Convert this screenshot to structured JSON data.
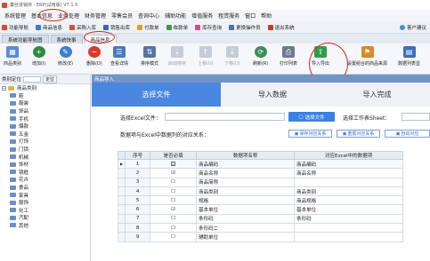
{
  "window": {
    "title": "秦丝进销存 - ERP(试用版) V7.1.5"
  },
  "menu": [
    "系统管理",
    "基本信息",
    "业务处理",
    "财务管理",
    "零售会员",
    "查询中心",
    "辅助功能",
    "增值服务",
    "租赁服务",
    "窗口",
    "帮助"
  ],
  "quickbar": {
    "items": [
      "功能导航",
      "商品信息",
      "采购入库",
      "销售出库",
      "付款单",
      "收款单",
      "库存查询",
      "更换操作员",
      "退出系统"
    ],
    "right": "客户建议"
  },
  "doc_tabs": [
    "系统功能导航图",
    "系统快事",
    "商品信息"
  ],
  "toolbar": [
    {
      "label": "商品类别",
      "color": "#5a8ad8",
      "glyph": "▦"
    },
    {
      "label": "增加(I)",
      "color": "#2e8b3e",
      "glyph": "+"
    },
    {
      "label": "修改(E)",
      "color": "#3b7dd8",
      "glyph": "✎"
    },
    {
      "label": "删除(D)",
      "color": "#d93a2e",
      "glyph": "−"
    },
    {
      "label": "查看详情",
      "color": "#4a79c2",
      "glyph": "☰"
    },
    {
      "label": "排序模式",
      "color": "#5573a8",
      "glyph": "⇅"
    },
    {
      "label": "启动排序",
      "color": "#aab4c0",
      "glyph": "⇣"
    },
    {
      "label": "上移(U)",
      "color": "#aab4c0",
      "glyph": "↑"
    },
    {
      "label": "下移(D)",
      "color": "#aab4c0",
      "glyph": "↓"
    },
    {
      "label": "刷新(R)",
      "color": "#3c8d5a",
      "glyph": "⟳"
    },
    {
      "label": "打印列表",
      "color": "#6b7a90",
      "glyph": "⎙"
    },
    {
      "label": "导入导出",
      "color": "#2f9e4a",
      "glyph": "⇪"
    },
    {
      "label": "设置组合的商品来源",
      "color": "#d88a2a",
      "glyph": "⚑"
    },
    {
      "label": "数据列表显",
      "color": "#3a6fc0",
      "glyph": "▤"
    }
  ],
  "left_panel": {
    "label": "类别定位",
    "button": "定位",
    "tree": [
      "商品类别",
      "鞋",
      "服装",
      "饰品",
      "手机",
      "爆款",
      "五金",
      "灯饰",
      "门锁",
      "机械",
      "饰材",
      "镜框",
      "花卉",
      "食品",
      "家具",
      "服饰",
      "化工",
      "汽配",
      "其他"
    ]
  },
  "main": {
    "title": "商品导入",
    "steps": [
      "选择文件",
      "导入数据",
      "导入完成"
    ],
    "file_label": "选择Excel文件：",
    "file_value": "",
    "choose_file_btn": "选择文件",
    "sheet_label": "选择工作表Sheet：",
    "sheet_value": "",
    "mapping_label": "数据项与Excel中数据列的对应关系：",
    "btn_save_mapping": "保存对应关系",
    "btn_reset_mapping": "重置对应关系",
    "btn_auto_mapping": "自动对应",
    "columns": [
      "序号",
      "是否必填",
      "数据项名称",
      "对应Excel中的数据项"
    ],
    "rows": [
      {
        "no": "1",
        "req": "☐",
        "name": "商品编码",
        "excel": "商品编码",
        "current": true
      },
      {
        "no": "2",
        "req": "☑",
        "name": "商品名称",
        "excel": "商品名称"
      },
      {
        "no": "3",
        "req": "☐",
        "name": "商品简称",
        "excel": ""
      },
      {
        "no": "4",
        "req": "☐",
        "name": "商品类别",
        "excel": "商品类别"
      },
      {
        "no": "5",
        "req": "☐",
        "name": "规格",
        "excel": "商品规格"
      },
      {
        "no": "6",
        "req": "☑",
        "name": "基本单位",
        "excel": "基本单位"
      },
      {
        "no": "7",
        "req": "☐",
        "name": "条形码",
        "excel": "条形码"
      },
      {
        "no": "8",
        "req": "☐",
        "name": "条形码二",
        "excel": ""
      },
      {
        "no": "9",
        "req": "☐",
        "name": "辅助单位",
        "excel": ""
      }
    ]
  }
}
